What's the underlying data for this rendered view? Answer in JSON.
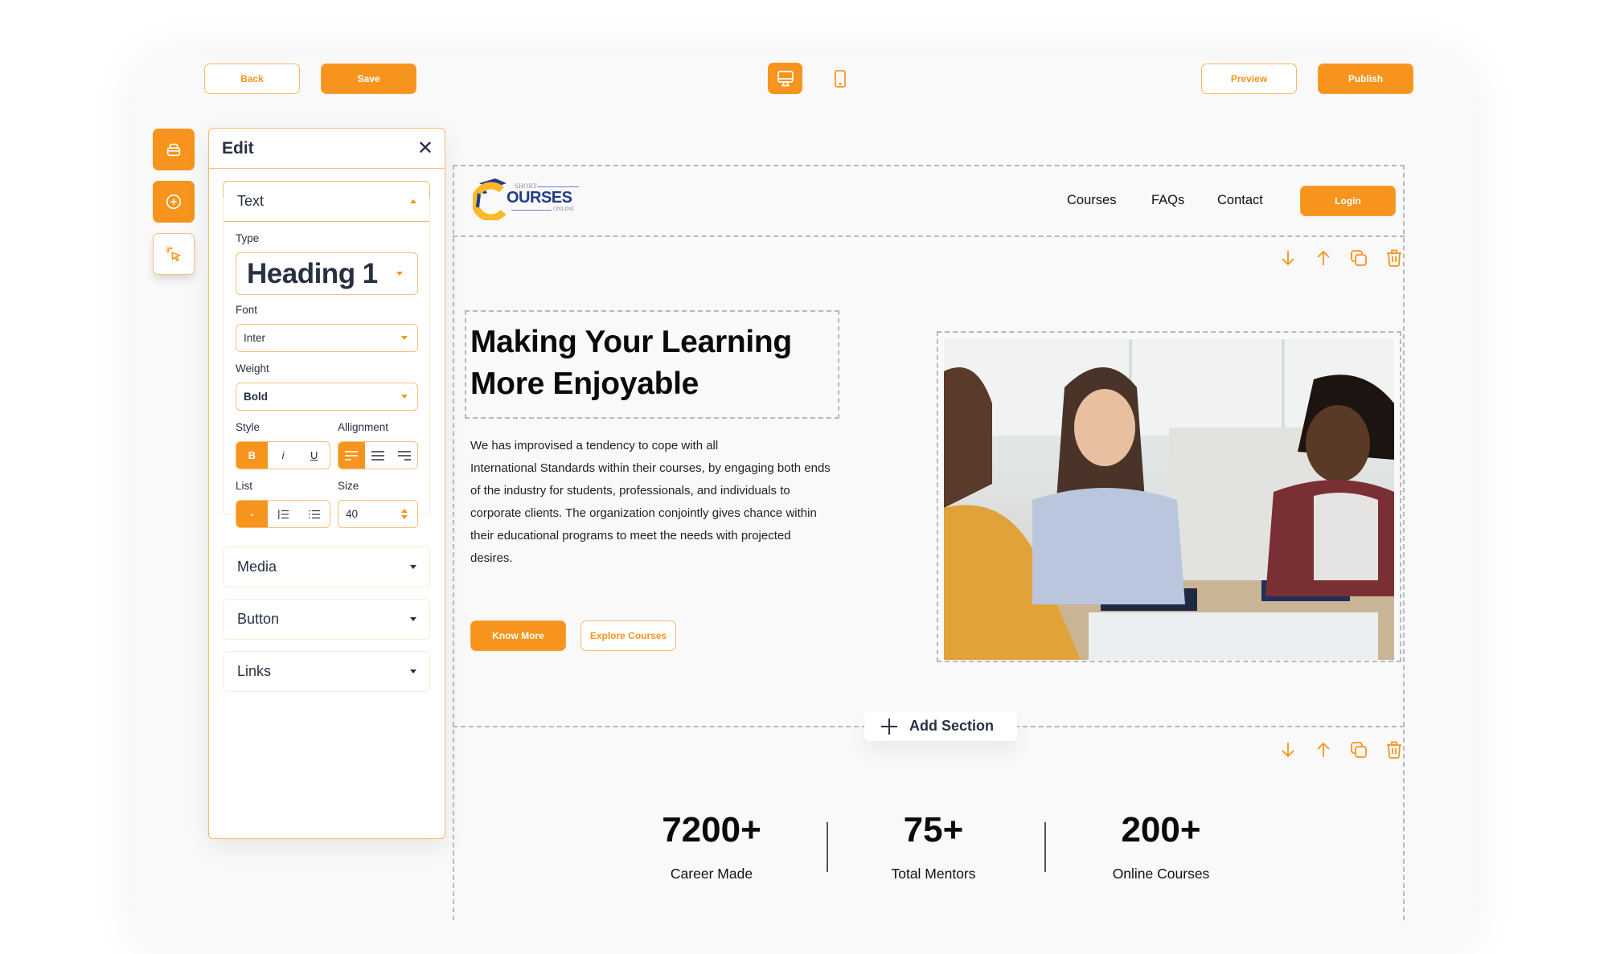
{
  "toolbar": {
    "back_label": "Back",
    "save_label": "Save",
    "preview_label": "Preview",
    "publish_label": "Publish",
    "view_modes": [
      {
        "icon": "desktop-icon",
        "active": true
      },
      {
        "icon": "mobile-icon",
        "active": false
      }
    ]
  },
  "side_tools": [
    {
      "icon": "layers-icon",
      "active": true
    },
    {
      "icon": "add-circle-icon",
      "active": true
    },
    {
      "icon": "cursor-click-icon",
      "active": false
    }
  ],
  "edit_panel": {
    "title": "Edit",
    "close_icon": "close-icon",
    "sections": {
      "text": {
        "label": "Text",
        "expanded": true,
        "type_label": "Type",
        "type_value": "Heading 1",
        "font_label": "Font",
        "font_value": "Inter",
        "weight_label": "Weight",
        "weight_value": "Bold",
        "style_label": "Style",
        "style_options": [
          {
            "label": "B",
            "active": true
          },
          {
            "label": "i",
            "active": false
          },
          {
            "label": "U",
            "active": false
          }
        ],
        "alignment_label": "Allignment",
        "alignment_options": [
          {
            "icon": "align-left-icon",
            "active": true
          },
          {
            "icon": "align-center-icon",
            "active": false
          },
          {
            "icon": "align-right-icon",
            "active": false
          }
        ],
        "list_label": "List",
        "list_options": [
          {
            "label": "-",
            "active": true
          },
          {
            "icon": "ordered-list-icon",
            "active": false
          },
          {
            "icon": "bullet-list-icon",
            "active": false
          }
        ],
        "size_label": "Size",
        "size_value": "40"
      },
      "media": {
        "label": "Media"
      },
      "button": {
        "label": "Button"
      },
      "links": {
        "label": "Links"
      }
    }
  },
  "site": {
    "logo": {
      "top": "SHORT",
      "main": "OURSES",
      "bottom": "ONLINE"
    },
    "nav": [
      "Courses",
      "FAQs",
      "Contact"
    ],
    "login_label": "Login",
    "hero": {
      "title_line1": "Making Your Learning",
      "title_line2": "More Enjoyable",
      "body_lines": [
        "We has improvised a tendency to cope with all",
        "International Standards within their courses, by engaging both ends",
        "of the industry for students, professionals, and individuals to",
        "corporate clients. The organization conjointly gives chance within",
        "their educational programs to meet the needs with projected",
        "desires."
      ],
      "primary_cta": "Know More",
      "secondary_cta": "Explore Courses",
      "image_alt": "Students discussing around a table with books"
    },
    "add_section_label": "Add Section",
    "section_actions": [
      "move-down-icon",
      "move-up-icon",
      "duplicate-icon",
      "delete-icon"
    ],
    "stats": [
      {
        "value": "7200+",
        "label": "Career Made"
      },
      {
        "value": "75+",
        "label": "Total Mentors"
      },
      {
        "value": "200+",
        "label": "Online Courses"
      }
    ]
  },
  "colors": {
    "accent": "#f7941d",
    "accent_border": "#f8b866",
    "text_dark": "#283142",
    "logo_blue": "#233a8a",
    "logo_yellow": "#fbb829"
  }
}
